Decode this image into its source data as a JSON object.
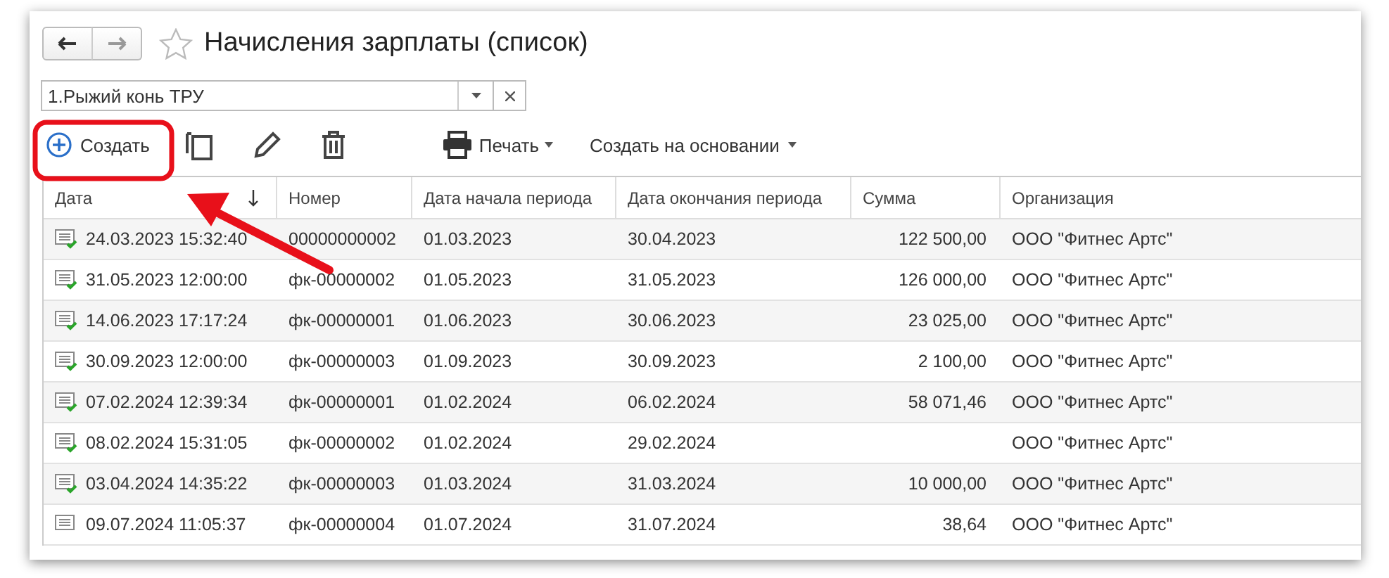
{
  "window": {
    "title": "Начисления зарплаты (список)",
    "favorite": false
  },
  "filter": {
    "value": "1.Рыжий конь ТРУ"
  },
  "toolbar": {
    "create": "Создать",
    "print": "Печать",
    "create_based": "Создать на основании"
  },
  "table": {
    "columns": [
      "Дата",
      "Номер",
      "Дата начала периода",
      "Дата окончания периода",
      "Сумма",
      "Организация"
    ],
    "rows": [
      {
        "posted": true,
        "cells": [
          "24.03.2023 15:32:40",
          "00000000002",
          "01.03.2023",
          "30.04.2023",
          "122 500,00",
          "ООО \"Фитнес Артс\""
        ]
      },
      {
        "posted": true,
        "cells": [
          "31.05.2023 12:00:00",
          "фк-00000002",
          "01.05.2023",
          "31.05.2023",
          "126 000,00",
          "ООО \"Фитнес Артс\""
        ]
      },
      {
        "posted": true,
        "cells": [
          "14.06.2023 17:17:24",
          "фк-00000001",
          "01.06.2023",
          "30.06.2023",
          "23 025,00",
          "ООО \"Фитнес Артс\""
        ]
      },
      {
        "posted": true,
        "cells": [
          "30.09.2023 12:00:00",
          "фк-00000003",
          "01.09.2023",
          "30.09.2023",
          "2 100,00",
          "ООО \"Фитнес Артс\""
        ]
      },
      {
        "posted": true,
        "cells": [
          "07.02.2024 12:39:34",
          "фк-00000001",
          "01.02.2024",
          "06.02.2024",
          "58 071,46",
          "ООО \"Фитнес Артс\""
        ]
      },
      {
        "posted": true,
        "cells": [
          "08.02.2024 15:31:05",
          "фк-00000002",
          "01.02.2024",
          "29.02.2024",
          "",
          "ООО \"Фитнес Артс\""
        ]
      },
      {
        "posted": true,
        "cells": [
          "03.04.2024 14:35:22",
          "фк-00000003",
          "01.03.2024",
          "31.03.2024",
          "10 000,00",
          "ООО \"Фитнес Артс\""
        ]
      },
      {
        "posted": false,
        "cells": [
          "09.07.2024 11:05:37",
          "фк-00000004",
          "01.07.2024",
          "31.07.2024",
          "38,64",
          "ООО \"Фитнес Артс\""
        ]
      }
    ]
  }
}
